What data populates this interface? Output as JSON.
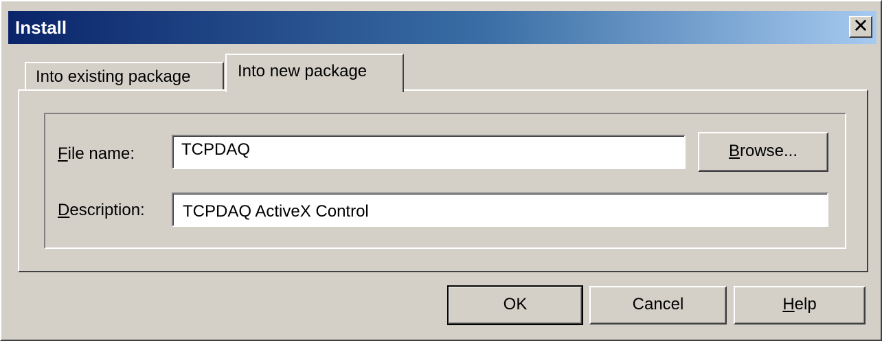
{
  "window": {
    "title": "Install"
  },
  "titlebar": {
    "close_glyph": "✕"
  },
  "tabs": [
    {
      "label": "Into existing package"
    },
    {
      "label": "Into new package"
    }
  ],
  "form": {
    "file_name_label_accel": "F",
    "file_name_label_rest": "ile name:",
    "file_name_value": "TCPDAQ",
    "description_label_accel": "D",
    "description_label_rest": "escription:",
    "description_value": "TCPDAQ ActiveX Control",
    "browse_accel": "B",
    "browse_rest": "rowse..."
  },
  "buttons": {
    "ok": "OK",
    "cancel": "Cancel",
    "help_accel": "H",
    "help_rest": "elp"
  },
  "colors": {
    "title_gradient_start": "#0a246a",
    "title_gradient_end": "#a6caf0",
    "face": "#d4d0c8"
  }
}
